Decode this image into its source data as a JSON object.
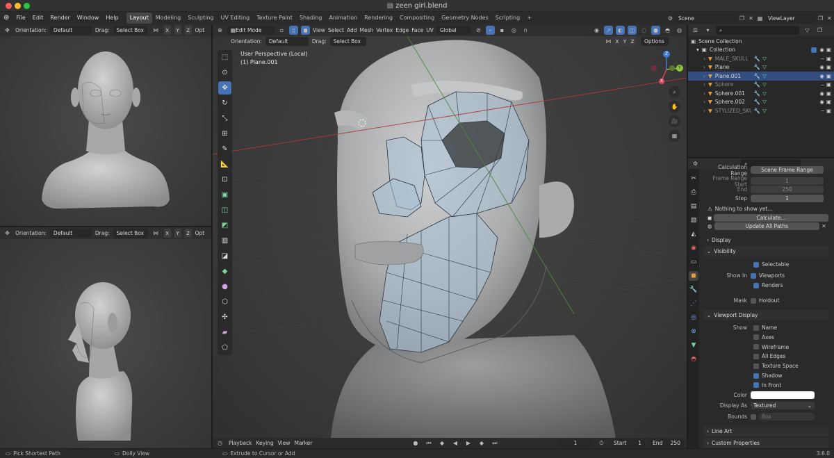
{
  "window": {
    "title": "zeen girl.blend"
  },
  "menubar": {
    "menus": [
      "File",
      "Edit",
      "Render",
      "Window",
      "Help"
    ],
    "workspaces": [
      "Layout",
      "Modeling",
      "Sculpting",
      "UV Editing",
      "Texture Paint",
      "Shading",
      "Animation",
      "Rendering",
      "Compositing",
      "Geometry Nodes",
      "Scripting"
    ],
    "active_workspace": "Layout",
    "add_tab": "+",
    "scene": "Scene",
    "view_layer": "ViewLayer"
  },
  "left_top_view": {
    "orientation_label": "Orientation:",
    "orientation_value": "Default",
    "drag_label": "Drag:",
    "drag_value": "Select Box",
    "axes": [
      "X",
      "Y",
      "Z"
    ],
    "options_cut": "Opt"
  },
  "left_bottom_view": {
    "orientation_label": "Orientation:",
    "orientation_value": "Default",
    "drag_label": "Drag:",
    "drag_value": "Select Box",
    "axes": [
      "X",
      "Y",
      "Z"
    ],
    "options_cut": "Opt"
  },
  "main_view": {
    "mode": "Edit Mode",
    "menus": [
      "View",
      "Select",
      "Add",
      "Mesh",
      "Vertex",
      "Edge",
      "Face",
      "UV"
    ],
    "transform_orientation": "Global",
    "orientation_label": "Orientation:",
    "orientation_value": "Default",
    "drag_label": "Drag:",
    "drag_value": "Select Box",
    "axes": [
      "X",
      "Y",
      "Z"
    ],
    "options": "Options",
    "overlay_title": "User Perspective (Local)",
    "overlay_object": "(1) Plane.001",
    "gizmo": {
      "z": "Z",
      "y": "Y",
      "x": "X"
    }
  },
  "outliner": {
    "root": "Scene Collection",
    "collection": "Collection",
    "items": [
      {
        "name": "MALE_SKULL",
        "dim": true,
        "selected": false
      },
      {
        "name": "Plane",
        "dim": false,
        "selected": false
      },
      {
        "name": "Plane.001",
        "dim": false,
        "selected": true
      },
      {
        "name": "Sphere",
        "dim": true,
        "selected": false
      },
      {
        "name": "Sphere.001",
        "dim": false,
        "selected": false
      },
      {
        "name": "Sphere.002",
        "dim": false,
        "selected": false
      },
      {
        "name": "STYLIZED_SKULL",
        "dim": true,
        "selected": false
      }
    ]
  },
  "properties": {
    "calc_range_label": "Calculation Range",
    "calc_range_value": "Scene Frame Range",
    "frame_range_start_label": "Frame Range Start",
    "frame_range_start": "1",
    "end_label": "End",
    "end": "250",
    "step_label": "Step",
    "step": "1",
    "warning": "Nothing to show yet...",
    "calculate": "Calculate...",
    "update_all_paths": "Update All Paths",
    "display_section": "Display",
    "visibility_section": "Visibility",
    "selectable": "Selectable",
    "show_in_label": "Show In",
    "viewports": "Viewports",
    "renders": "Renders",
    "mask_label": "Mask",
    "holdout": "Holdout",
    "viewport_display_section": "Viewport Display",
    "show_label": "Show",
    "show_items": [
      {
        "label": "Name",
        "checked": false
      },
      {
        "label": "Axes",
        "checked": false
      },
      {
        "label": "Wireframe",
        "checked": false
      },
      {
        "label": "All Edges",
        "checked": false
      },
      {
        "label": "Texture Space",
        "checked": false
      },
      {
        "label": "Shadow",
        "checked": true
      },
      {
        "label": "In Front",
        "checked": true
      }
    ],
    "color_label": "Color",
    "display_as_label": "Display As",
    "display_as_value": "Textured",
    "bounds_label": "Bounds",
    "bounds_value": "Box",
    "line_art_section": "Line Art",
    "custom_properties_section": "Custom Properties"
  },
  "timeline": {
    "menus": [
      "Playback",
      "Keying",
      "View",
      "Marker"
    ],
    "current_frame": "1",
    "start_label": "Start",
    "start": "1",
    "end_label": "End",
    "end": "250"
  },
  "statusbar": {
    "left": "Pick Shortest Path",
    "middle": "Dolly View",
    "hint": "Extrude to Cursor or Add",
    "version": "3.6.0"
  },
  "colors": {
    "accent": "#4772b3",
    "selected_row": "#334d80",
    "header": "#2f2f2f",
    "viewport": "#3d3d3d"
  }
}
